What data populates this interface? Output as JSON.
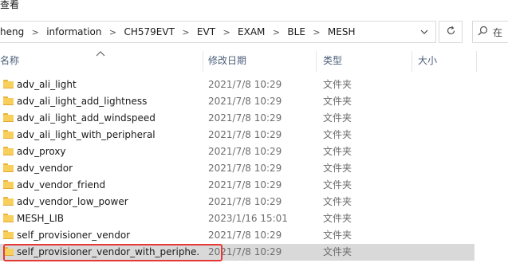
{
  "menu": {
    "view_label": "查看"
  },
  "address": {
    "crumbs": [
      "heng",
      "information",
      "CH579EVT",
      "EVT",
      "EXAM",
      "BLE",
      "MESH"
    ],
    "separator": ">"
  },
  "search": {
    "placeholder": "在"
  },
  "columns": {
    "name": "名称",
    "modified": "修改日期",
    "type": "类型",
    "size": "大小"
  },
  "files": [
    {
      "name": "adv_ali_light",
      "modified": "2021/7/8 10:29",
      "type": "文件夹"
    },
    {
      "name": "adv_ali_light_add_lightness",
      "modified": "2021/7/8 10:29",
      "type": "文件夹"
    },
    {
      "name": "adv_ali_light_add_windspeed",
      "modified": "2021/7/8 10:29",
      "type": "文件夹"
    },
    {
      "name": "adv_ali_light_with_peripheral",
      "modified": "2021/7/8 10:29",
      "type": "文件夹"
    },
    {
      "name": "adv_proxy",
      "modified": "2021/7/8 10:29",
      "type": "文件夹"
    },
    {
      "name": "adv_vendor",
      "modified": "2021/7/8 10:29",
      "type": "文件夹"
    },
    {
      "name": "adv_vendor_friend",
      "modified": "2021/7/8 10:29",
      "type": "文件夹"
    },
    {
      "name": "adv_vendor_low_power",
      "modified": "2021/7/8 10:29",
      "type": "文件夹"
    },
    {
      "name": "MESH_LIB",
      "modified": "2023/1/16 15:01",
      "type": "文件夹"
    },
    {
      "name": "self_provisioner_vendor",
      "modified": "2021/7/8 10:29",
      "type": "文件夹"
    },
    {
      "name": "self_provisioner_vendor_with_periphe...",
      "modified": "2021/7/8 10:29",
      "type": "文件夹"
    }
  ],
  "selected_index": 10,
  "colors": {
    "highlight": "#e53935",
    "folder": "#f8cf5b",
    "selected_row": "#d9d9d9"
  }
}
